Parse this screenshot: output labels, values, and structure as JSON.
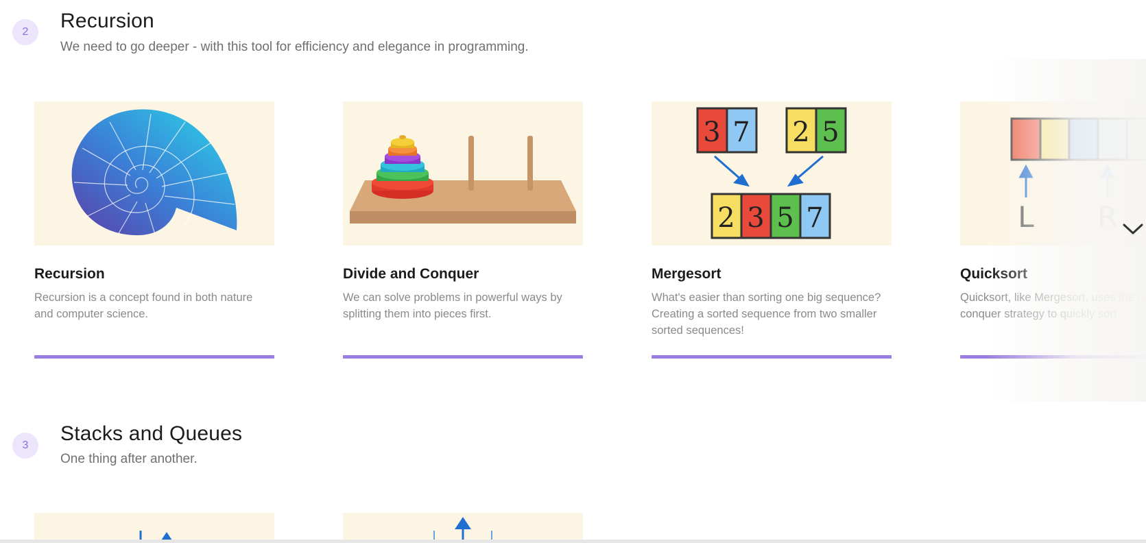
{
  "chapters": [
    {
      "number": "2",
      "title": "Recursion",
      "subtitle": "We need to go deeper - with this tool for efficiency and elegance in programming.",
      "cards": [
        {
          "title": "Recursion",
          "description": "Recursion is a concept found in both nature and computer science.",
          "image": "nautilus-shell-illustration"
        },
        {
          "title": "Divide and Conquer",
          "description": "We can solve problems in powerful ways by splitting them into pieces first.",
          "image": "tower-of-hanoi-illustration"
        },
        {
          "title": "Mergesort",
          "description": "What's easier than sorting one big sequence? Creating a sorted sequence from two smaller sorted sequences!",
          "image": "merge-diagram-illustration",
          "left_digits": [
            "3",
            "7"
          ],
          "right_digits": [
            "2",
            "5"
          ],
          "merged_digits": [
            "2",
            "3",
            "5",
            "7"
          ]
        },
        {
          "title": "Quicksort",
          "description": "Quicksort, like Mergesort, uses the divide-and-conquer strategy to quickly sort",
          "image": "partition-pointers-illustration",
          "pointer_left": "L",
          "pointer_right": "R"
        }
      ]
    },
    {
      "number": "3",
      "title": "Stacks and Queues",
      "subtitle": "One thing after another.",
      "cards": [
        {
          "title": "",
          "description": "",
          "image": "stack-arrows-illustration"
        },
        {
          "title": "",
          "description": "",
          "image": "queue-arrow-illustration"
        }
      ]
    }
  ],
  "icons": {
    "scroll_right": "chevron-down-icon"
  },
  "colors": {
    "accent": "#9b7fe0",
    "badge_bg": "#ece5fb",
    "card_bg": "#fdf5e4"
  }
}
